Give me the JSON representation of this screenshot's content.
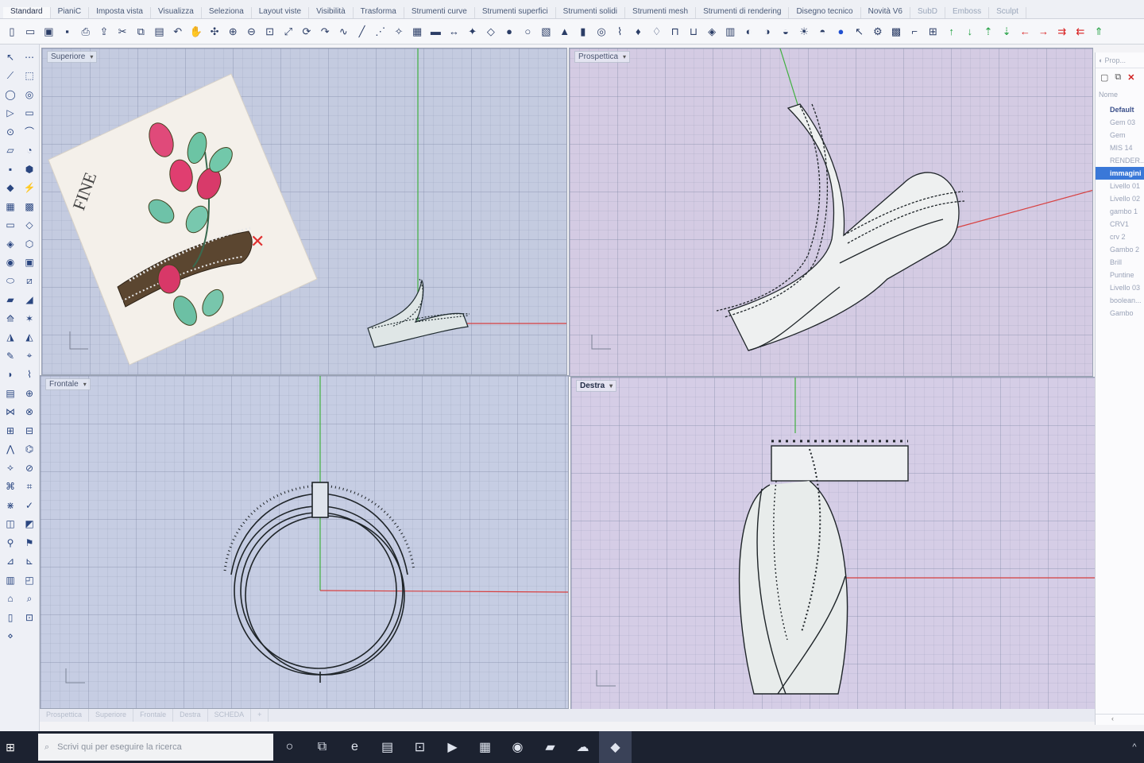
{
  "tabs": [
    "Standard",
    "PianiC",
    "Imposta vista",
    "Visualizza",
    "Seleziona",
    "Layout viste",
    "Visibilità",
    "Trasforma",
    "Strumenti curve",
    "Strumenti superfici",
    "Strumenti solidi",
    "Strumenti mesh",
    "Strumenti di rendering",
    "Disegno tecnico",
    "Novità V6",
    "SubD",
    "Emboss",
    "Sculpt"
  ],
  "toolbar_icons": [
    "new-file",
    "open-file",
    "save",
    "save-small",
    "print",
    "import",
    "cut",
    "copy",
    "paste",
    "undo",
    "pan",
    "move",
    "zoom-in",
    "zoom-out",
    "zoom-window",
    "zoom-extents",
    "rotate-view",
    "redo",
    "curve-tool",
    "line-tool",
    "polyline",
    "snap",
    "grid",
    "car",
    "dims",
    "light",
    "gem",
    "sphere",
    "circle",
    "box",
    "cone",
    "cylinder",
    "torus",
    "pipe",
    "lamp",
    "bulb",
    "lock",
    "unlock",
    "material",
    "layer",
    "render",
    "env",
    "ground",
    "sun",
    "sky",
    "sphere-blue",
    "pointer",
    "gear",
    "block",
    "frame",
    "xform",
    "arrow-up",
    "arrow-down",
    "arrow-up2",
    "arrow-down2",
    "arrow-left",
    "arrow-right",
    "double-right",
    "double-left",
    "arrow-up3"
  ],
  "viewports": {
    "top": {
      "label": "Superiore"
    },
    "perspective": {
      "label": "Prospettica"
    },
    "front": {
      "label": "Frontale"
    },
    "right": {
      "label": "Destra"
    }
  },
  "viewport_tabs": [
    "Prospettica",
    "Superiore",
    "Frontale",
    "Destra",
    "SCHEDA"
  ],
  "right_panel": {
    "tab_label": "Prop...",
    "header": "Nome",
    "layers": [
      "Default",
      "Gem 03",
      "Gem",
      "MIS 14",
      "RENDER...",
      "immagini",
      "Livello 01",
      "Livello 02",
      "gambo 1",
      "CRV1",
      "crv 2",
      "Gambo 2",
      "Brill",
      "Puntine",
      "Livello 03",
      "boolean...",
      "Gambo"
    ],
    "selected_layer": "immagini"
  },
  "taskbar": {
    "search_placeholder": "Scrivi qui per eseguire la ricerca"
  },
  "colors": {
    "axis_x": "#d84040",
    "axis_y": "#40b040",
    "selection": "#3a78d8",
    "taskbar": "#1c2230"
  },
  "sketch": {
    "annotation": "FINE"
  }
}
